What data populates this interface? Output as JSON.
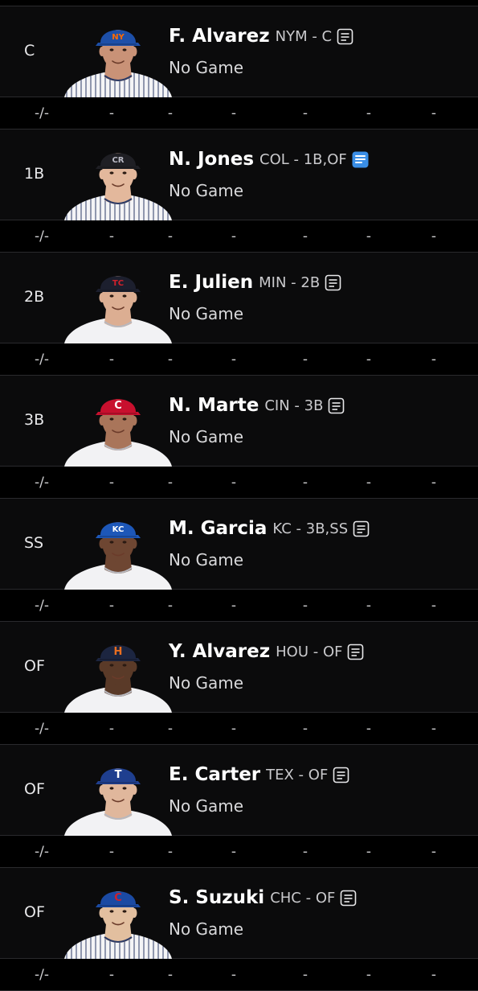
{
  "colors": {
    "background": "#000000",
    "row": "#0b0b0c",
    "note_active": "#3a8ee6"
  },
  "players": [
    {
      "position": "C",
      "name": "F. Alvarez",
      "team_pos": "NYM - C",
      "status": "No Game",
      "note_icon": "note-icon",
      "cap_color": "#1d4fa8",
      "logo": "NY",
      "logo_color": "#ff6a00",
      "skin": "#c99277",
      "jersey": "pinstripe",
      "stats": [
        "-/-",
        "-",
        "-",
        "-",
        "-",
        "-",
        "-"
      ]
    },
    {
      "position": "1B",
      "name": "N. Jones",
      "team_pos": "COL - 1B,OF",
      "status": "No Game",
      "note_icon": "note-active-icon",
      "cap_color": "#1f1f24",
      "logo": "CR",
      "logo_color": "#b9b9c4",
      "skin": "#e3b89c",
      "jersey": "pinstripe",
      "stats": [
        "-/-",
        "-",
        "-",
        "-",
        "-",
        "-",
        "-"
      ]
    },
    {
      "position": "2B",
      "name": "E. Julien",
      "team_pos": "MIN - 2B",
      "status": "No Game",
      "note_icon": "note-icon",
      "cap_color": "#1c1f2e",
      "logo": "TC",
      "logo_color": "#d0202b",
      "skin": "#dcae92",
      "jersey": "white",
      "stats": [
        "-/-",
        "-",
        "-",
        "-",
        "-",
        "-",
        "-"
      ]
    },
    {
      "position": "3B",
      "name": "N. Marte",
      "team_pos": "CIN - 3B",
      "status": "No Game",
      "note_icon": "note-icon",
      "cap_color": "#c8102e",
      "logo": "C",
      "logo_color": "#ffffff",
      "skin": "#a9755a",
      "jersey": "white",
      "stats": [
        "-/-",
        "-",
        "-",
        "-",
        "-",
        "-",
        "-"
      ]
    },
    {
      "position": "SS",
      "name": "M. Garcia",
      "team_pos": "KC - 3B,SS",
      "status": "No Game",
      "note_icon": "note-icon",
      "cap_color": "#1d57b8",
      "logo": "KC",
      "logo_color": "#ffffff",
      "skin": "#6e4632",
      "jersey": "white",
      "stats": [
        "-/-",
        "-",
        "-",
        "-",
        "-",
        "-",
        "-"
      ]
    },
    {
      "position": "OF",
      "name": "Y. Alvarez",
      "team_pos": "HOU - OF",
      "status": "No Game",
      "note_icon": "note-icon",
      "cap_color": "#1c2540",
      "logo": "H",
      "logo_color": "#eb6e1f",
      "skin": "#5a3a28",
      "jersey": "white",
      "stats": [
        "-/-",
        "-",
        "-",
        "-",
        "-",
        "-",
        "-"
      ]
    },
    {
      "position": "OF",
      "name": "E. Carter",
      "team_pos": "TEX - OF",
      "status": "No Game",
      "note_icon": "note-icon",
      "cap_color": "#1f3f8f",
      "logo": "T",
      "logo_color": "#ffffff",
      "skin": "#e0b79c",
      "jersey": "white",
      "stats": [
        "-/-",
        "-",
        "-",
        "-",
        "-",
        "-",
        "-"
      ]
    },
    {
      "position": "OF",
      "name": "S. Suzuki",
      "team_pos": "CHC - OF",
      "status": "No Game",
      "note_icon": "note-icon",
      "cap_color": "#1b4aa3",
      "logo": "C",
      "logo_color": "#d0202b",
      "skin": "#e2bf9f",
      "jersey": "pinstripe",
      "stats": [
        "-/-",
        "-",
        "-",
        "-",
        "-",
        "-",
        "-"
      ]
    }
  ]
}
